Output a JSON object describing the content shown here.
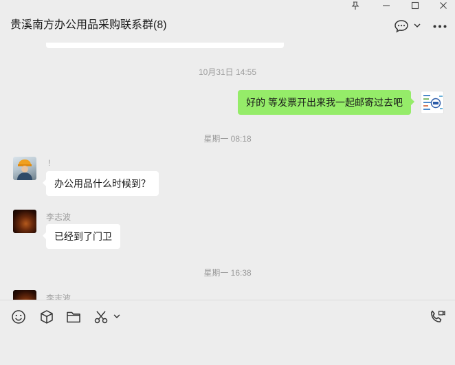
{
  "window": {
    "title": "贵溪南方办公用品采购联系群(8)",
    "controls": [
      "pin-icon",
      "minimize-icon",
      "maximize-icon",
      "close-icon"
    ]
  },
  "header_actions": [
    "chat-bubble-icon",
    "chevron-down-icon",
    "more-icon"
  ],
  "chat": {
    "timestamps": [
      "10月31日 14:55",
      "星期一 08:18",
      "星期一 16:38"
    ],
    "messages": [
      {
        "sender": "",
        "text": "好的 等发票开出来我一起邮寄过去吧",
        "direction": "out"
      },
      {
        "sender": "!",
        "text": "办公用品什么时候到？",
        "direction": "in"
      },
      {
        "sender": "李志波",
        "text": "已经到了门卫",
        "direction": "in"
      },
      {
        "sender": "李志波",
        "text": "",
        "direction": "in"
      }
    ]
  },
  "toolbar": {
    "icons": [
      "emoji-icon",
      "box-icon",
      "folder-icon",
      "scissors-icon",
      "chevron-down-icon",
      "call-icon"
    ]
  },
  "colors": {
    "background": "#ededed",
    "outgoing_bubble": "#95ec69",
    "incoming_bubble": "#ffffff",
    "timestamp_text": "#9b9b9b"
  }
}
